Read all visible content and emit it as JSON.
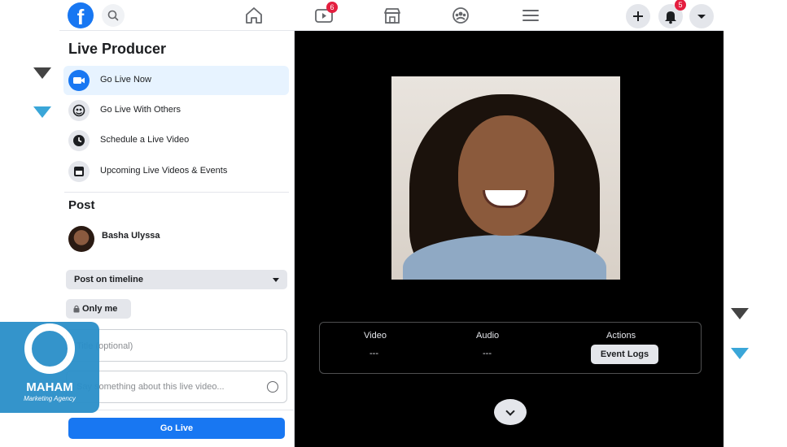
{
  "topbar": {
    "logo": "f",
    "icons": [
      "search-icon",
      "home-icon",
      "watch-icon",
      "marketplace-icon",
      "groups-icon",
      "menu-icon",
      "plus-icon",
      "bell-icon",
      "chevron-down-icon"
    ],
    "watch_badge": "6",
    "notif_badge": "5"
  },
  "sidebar": {
    "title": "Live Producer",
    "items": [
      {
        "label": "Go Live Now",
        "icon": "video-camera-icon"
      },
      {
        "label": "Go Live With Others",
        "icon": "users-icon"
      },
      {
        "label": "Schedule a Live Video",
        "icon": "clock-icon"
      },
      {
        "label": "Upcoming Live Videos & Events",
        "icon": "calendar-icon"
      }
    ],
    "post_title": "Post",
    "user_name": "Basha Ulyssa",
    "destination": "Post on timeline",
    "privacy": "Only me",
    "title_placeholder": "Title (optional)",
    "description_placeholder": "Say something about this live video...",
    "go_live": "Go Live"
  },
  "stage": {
    "video_label": "Video",
    "video_value": "---",
    "audio_label": "Audio",
    "audio_value": "---",
    "actions_label": "Actions",
    "event_logs": "Event Logs"
  },
  "watermark": {
    "title": "MAHAM",
    "subtitle": "Marketing Agency"
  },
  "colors": {
    "brand": "#1877f2",
    "badge": "#e41e3f",
    "stage": "#000000",
    "arrow_dark": "#444444",
    "arrow_blue": "#3aa6d8"
  }
}
